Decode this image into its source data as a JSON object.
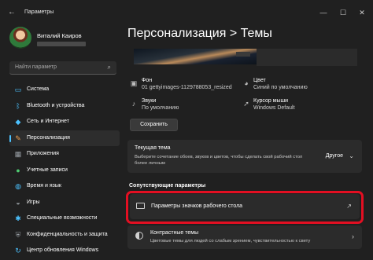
{
  "window": {
    "title": "Параметры",
    "controls": {
      "minimize": "—",
      "maximize": "☐",
      "close": "✕"
    },
    "back_icon": "arrow-left-icon"
  },
  "user": {
    "name": "Виталий Каиров"
  },
  "search": {
    "placeholder": "Найти параметр",
    "icon": "search-icon"
  },
  "sidebar": {
    "items": [
      {
        "label": "Система",
        "icon": "monitor-icon",
        "color": "#4cc2ff"
      },
      {
        "label": "Bluetooth и устройства",
        "icon": "bluetooth-icon",
        "color": "#4cc2ff"
      },
      {
        "label": "Сеть и Интернет",
        "icon": "wifi-icon",
        "color": "#4cc2ff"
      },
      {
        "label": "Персонализация",
        "icon": "brush-icon",
        "color": "#f0a050",
        "active": true
      },
      {
        "label": "Приложения",
        "icon": "apps-icon",
        "color": "#9aa0a6"
      },
      {
        "label": "Учетные записи",
        "icon": "person-icon",
        "color": "#4ecb71"
      },
      {
        "label": "Время и язык",
        "icon": "globe-icon",
        "color": "#4cc2ff"
      },
      {
        "label": "Игры",
        "icon": "gamepad-icon",
        "color": "#9aa0a6"
      },
      {
        "label": "Специальные возможности",
        "icon": "accessibility-icon",
        "color": "#4cc2ff"
      },
      {
        "label": "Конфиденциальность и защита",
        "icon": "shield-icon",
        "color": "#9aa0a6"
      },
      {
        "label": "Центр обновления Windows",
        "icon": "refresh-icon",
        "color": "#4cc2ff"
      }
    ]
  },
  "header": {
    "title": "Персонализация  >  Темы"
  },
  "theme_info": {
    "background": {
      "label": "Фон",
      "value": "01 gettyimages-1129788053_resized"
    },
    "color": {
      "label": "Цвет",
      "value": "Синий по умолчанию"
    },
    "sounds": {
      "label": "Звуки",
      "value": "По умолчанию"
    },
    "cursor": {
      "label": "Курсор мыши",
      "value": "Windows Default"
    }
  },
  "save_button": {
    "label": "Сохранить"
  },
  "current_theme": {
    "title": "Текущая тема",
    "description": "Выберите сочетание обоев, звуков и цветов, чтобы сделать свой рабочий стол более личным",
    "value": "Другое"
  },
  "related": {
    "heading": "Сопутствующие параметры",
    "desktop_icons": {
      "label": "Параметры значков рабочего стола"
    },
    "contrast": {
      "title": "Контрастные темы",
      "description": "Цветовые темы для людей со слабым зрением, чувствительностью к свету"
    }
  },
  "colors": {
    "accent": "#4cc2ff",
    "highlight": "#e30f22",
    "bg": "#202020",
    "card": "#2b2b2b"
  }
}
